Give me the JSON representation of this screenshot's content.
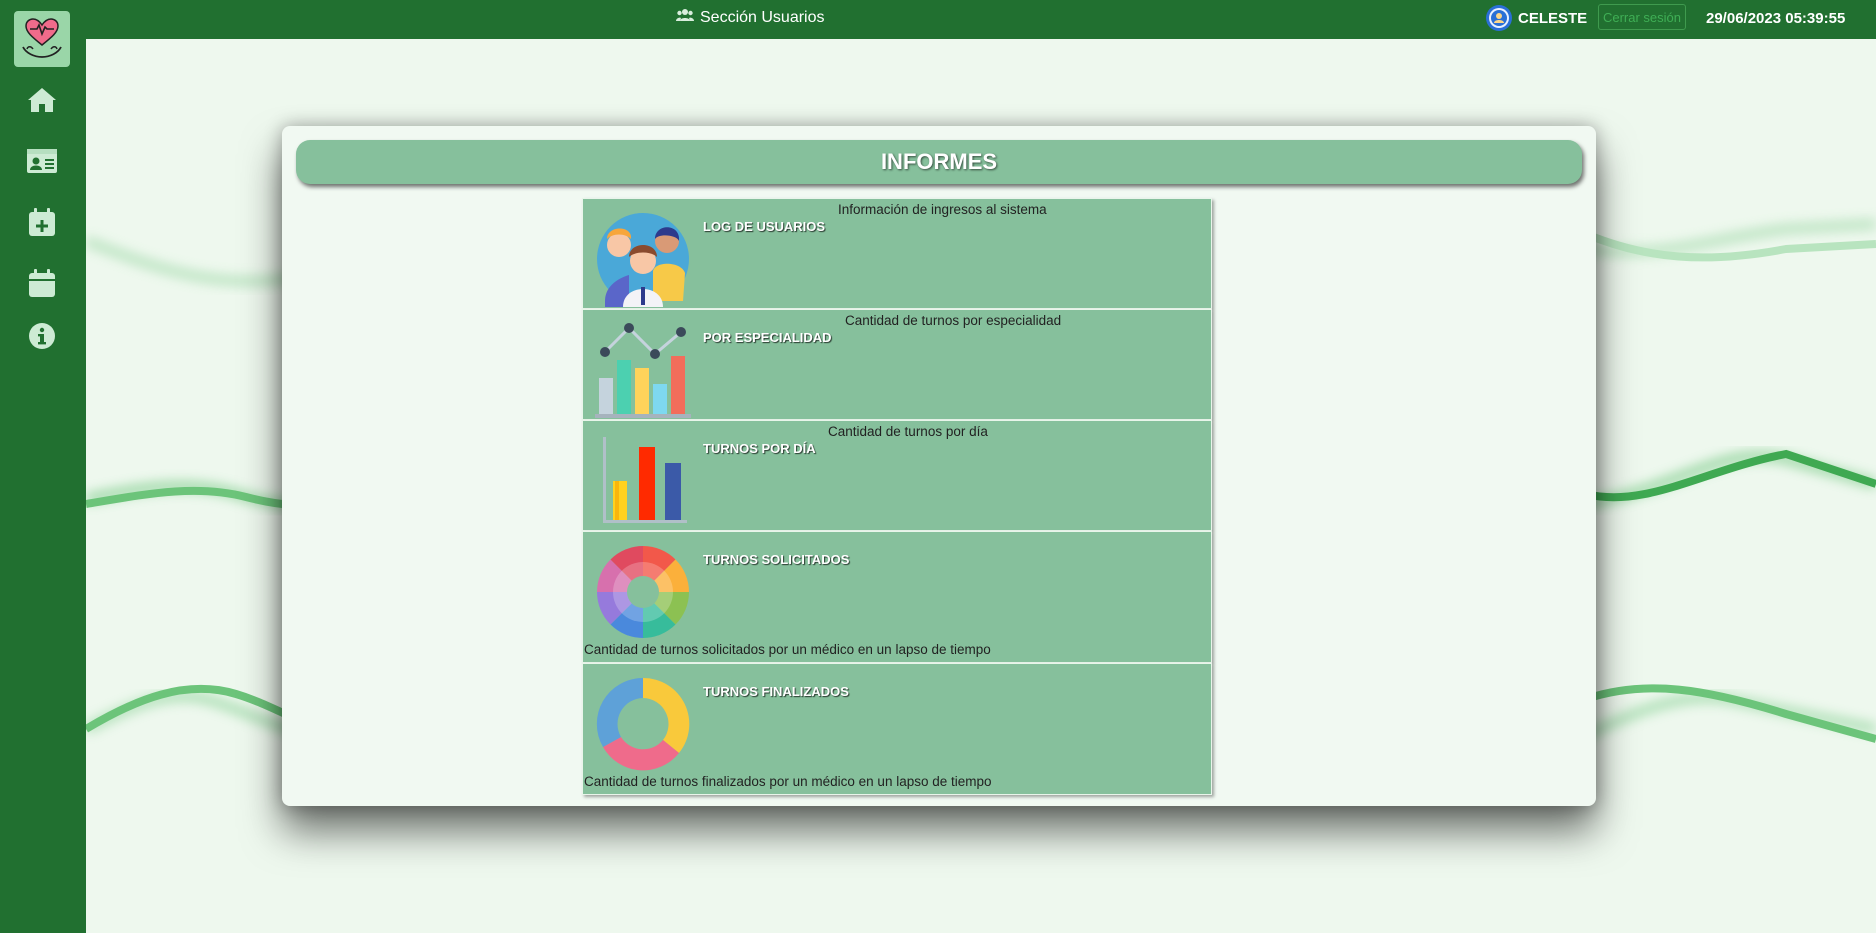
{
  "header": {
    "section_title": "Sección Usuarios",
    "user_name": "CELESTE",
    "logout_label": "Cerrar sesión",
    "datetime": "29/06/2023 05:39:55"
  },
  "sidebar": {
    "items": [
      {
        "icon": "home-icon"
      },
      {
        "icon": "id-card-icon"
      },
      {
        "icon": "calendar-plus-icon"
      },
      {
        "icon": "calendar-icon"
      },
      {
        "icon": "info-icon"
      }
    ]
  },
  "panel": {
    "title": "INFORMES",
    "reports": [
      {
        "title": "LOG DE USUARIOS",
        "description": "Información de ingresos al sistema",
        "icon": "users-group-icon"
      },
      {
        "title": "POR ESPECIALIDAD",
        "description": "Cantidad de turnos por especialidad",
        "icon": "bar-line-chart-icon"
      },
      {
        "title": "TURNOS POR DÍA",
        "description": "Cantidad de turnos por día",
        "icon": "bar-chart-icon"
      },
      {
        "title": "TURNOS SOLICITADOS",
        "description": "Cantidad de turnos solicitados por un médico en un lapso de tiempo",
        "icon": "color-wheel-icon"
      },
      {
        "title": "TURNOS FINALIZADOS",
        "description": "Cantidad de turnos finalizados por un médico en un lapso de tiempo",
        "icon": "donut-chart-icon"
      }
    ]
  },
  "colors": {
    "primary": "#217030",
    "panel_accent": "#86c09c",
    "background": "#eef8ee"
  }
}
